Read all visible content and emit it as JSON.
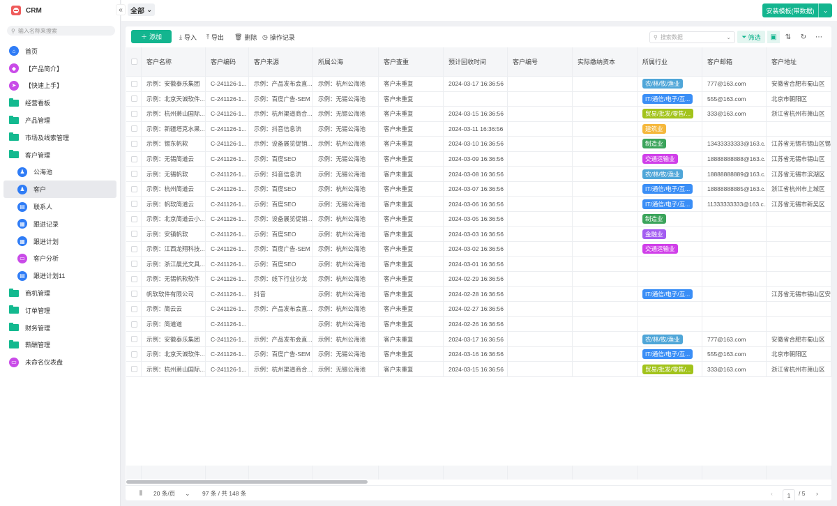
{
  "app": {
    "title": "CRM",
    "search_placeholder": "输入名称来搜索"
  },
  "sidebar": {
    "items": [
      {
        "label": "首页",
        "type": "icon",
        "icon": "home-icon",
        "color": "#2f7cf6",
        "glyph": "⌂"
      },
      {
        "label": "【产品简介】",
        "type": "icon",
        "icon": "tag-icon",
        "color": "#c94be8",
        "glyph": "◆"
      },
      {
        "label": "【快速上手】",
        "type": "icon",
        "icon": "send-icon",
        "color": "#c94be8",
        "glyph": "➤"
      },
      {
        "label": "经营看板",
        "type": "folder"
      },
      {
        "label": "产品管理",
        "type": "folder"
      },
      {
        "label": "市场及线索管理",
        "type": "folder"
      },
      {
        "label": "客户管理",
        "type": "folder",
        "open": true
      },
      {
        "label": "公海池",
        "type": "sub",
        "icon": "users-icon",
        "color": "#2f7cf6",
        "glyph": "♟"
      },
      {
        "label": "客户",
        "type": "sub",
        "icon": "user-icon",
        "color": "#2f7cf6",
        "glyph": "♟",
        "active": true
      },
      {
        "label": "联系人",
        "type": "sub",
        "icon": "contact-icon",
        "color": "#2f7cf6",
        "glyph": "▤"
      },
      {
        "label": "跟进记录",
        "type": "sub",
        "icon": "record-icon",
        "color": "#2f7cf6",
        "glyph": "▦"
      },
      {
        "label": "跟进计划",
        "type": "sub",
        "icon": "calendar-icon",
        "color": "#2f7cf6",
        "glyph": "▦"
      },
      {
        "label": "客户分析",
        "type": "sub",
        "icon": "dashboard-icon",
        "color": "#c94be8",
        "glyph": "▭"
      },
      {
        "label": "跟进计划11",
        "type": "sub",
        "icon": "document-icon",
        "color": "#2f7cf6",
        "glyph": "▤"
      },
      {
        "label": "商机管理",
        "type": "folder"
      },
      {
        "label": "订单管理",
        "type": "folder"
      },
      {
        "label": "财务管理",
        "type": "folder"
      },
      {
        "label": "薪酬管理",
        "type": "folder"
      },
      {
        "label": "未命名仪表盘",
        "type": "icon",
        "icon": "dashboard-icon",
        "color": "#c94be8",
        "glyph": "▭"
      }
    ]
  },
  "topbar": {
    "filter_label": "全部",
    "install_label": "安装模板(带数据)"
  },
  "toolbar": {
    "add": "添加",
    "import": "导入",
    "export": "导出",
    "delete": "删除",
    "log": "操作记录",
    "search_placeholder": "搜索数据",
    "filter": "筛选"
  },
  "table": {
    "columns": [
      "客户名称",
      "客户编码",
      "客户来源",
      "所属公海",
      "客户查重",
      "预计回收时间",
      "客户编号",
      "实际缴纳资本",
      "所属行业",
      "客户邮箱",
      "客户地址"
    ],
    "industry_colors": {
      "农/林/牧/渔业": "#4fa6d8",
      "IT/通信/电子/互...": "#3a8ef6",
      "贸易/批发/零售/...": "#a2c31b",
      "建筑业": "#f5b83c",
      "制造业": "#3ba45b",
      "交通运输业": "#d03fe9",
      "金融业": "#a35df1"
    },
    "rows": [
      [
        "示例：安徽泰乐集团",
        "C-241126-1...",
        "示例：产品发布会直...",
        "示例：杭州公海池",
        "客户未重复",
        "2024-03-17 16:36:56",
        "",
        "",
        "农/林/牧/渔业",
        "777@163.com",
        "安徽省合肥市蜀山区"
      ],
      [
        "示例：北京天诚软件...",
        "C-241126-1...",
        "示例：百度广告-SEM",
        "示例：无锡公海池",
        "客户未重复",
        "",
        "",
        "",
        "IT/通信/电子/互...",
        "555@163.com",
        "北京市朝阳区"
      ],
      [
        "示例：杭州萧山国际...",
        "C-241126-1...",
        "示例：杭州渠道商合...",
        "示例：无锡公海池",
        "客户未重复",
        "2024-03-15 16:36:56",
        "",
        "",
        "贸易/批发/零售/...",
        "333@163.com",
        "浙江省杭州市萧山区"
      ],
      [
        "示例：新疆塔克水果...",
        "C-241126-1...",
        "示例：抖音信息流",
        "示例：无锡公海池",
        "客户未重复",
        "2024-03-11 16:36:56",
        "",
        "",
        "建筑业",
        "",
        ""
      ],
      [
        "示例：锡东帆软",
        "C-241126-1...",
        "示例：设备展览促销...",
        "示例：杭州公海池",
        "客户未重复",
        "2024-03-10 16:36:56",
        "",
        "",
        "制造业",
        "13433333333@163.c...",
        "江苏省无锡市锡山区锡东"
      ],
      [
        "示例：无锡简道云",
        "C-241126-1...",
        "示例：百度SEO",
        "示例：无锡公海池",
        "客户未重复",
        "2024-03-09 16:36:56",
        "",
        "",
        "交通运输业",
        "18888888888@163.c...",
        "江苏省无锡市锡山区"
      ],
      [
        "示例：无锡帆软",
        "C-241126-1...",
        "示例：抖音信息流",
        "示例：无锡公海池",
        "客户未重复",
        "2024-03-08 16:36:56",
        "",
        "",
        "农/林/牧/渔业",
        "18888888889@163.c...",
        "江苏省无锡市滨湖区"
      ],
      [
        "示例：杭州简道云",
        "C-241126-1...",
        "示例：百度SEO",
        "示例：杭州公海池",
        "客户未重复",
        "2024-03-07 16:36:56",
        "",
        "",
        "IT/通信/电子/互...",
        "18888888885@163.c...",
        "浙江省杭州市上城区"
      ],
      [
        "示例：帆软简道云",
        "C-241126-1...",
        "示例：百度SEO",
        "示例：无锡公海池",
        "客户未重复",
        "2024-03-06 16:36:56",
        "",
        "",
        "IT/通信/电子/互...",
        "11333333333@163.c...",
        "江苏省无锡市新吴区"
      ],
      [
        "示例：北京简道云小...",
        "C-241126-1...",
        "示例：设备展览促销...",
        "示例：杭州公海池",
        "客户未重复",
        "2024-03-05 16:36:56",
        "",
        "",
        "制造业",
        "",
        ""
      ],
      [
        "示例：安镇帆软",
        "C-241126-1...",
        "示例：百度SEO",
        "示例：杭州公海池",
        "客户未重复",
        "2024-03-03 16:36:56",
        "",
        "",
        "金融业",
        "",
        ""
      ],
      [
        "示例：江西龙翔科技...",
        "C-241126-1...",
        "示例：百度广告-SEM",
        "示例：杭州公海池",
        "客户未重复",
        "2024-03-02 16:36:56",
        "",
        "",
        "交通运输业",
        "",
        ""
      ],
      [
        "示例：浙江晨光文具...",
        "C-241126-1...",
        "示例：百度SEO",
        "示例：杭州公海池",
        "客户未重复",
        "2024-03-01 16:36:56",
        "",
        "",
        "",
        "",
        ""
      ],
      [
        "示例：无锡帆软软件",
        "C-241126-1...",
        "示例：线下行业沙龙",
        "示例：杭州公海池",
        "客户未重复",
        "2024-02-29 16:36:56",
        "",
        "",
        "",
        "",
        ""
      ],
      [
        "帆软软件有限公司",
        "C-241126-1...",
        "抖音",
        "示例：杭州公海池",
        "客户未重复",
        "2024-02-28 16:36:56",
        "",
        "",
        "IT/通信/电子/互...",
        "",
        "江苏省无锡市锡山区安镇"
      ],
      [
        "示例：简云云",
        "C-241126-1...",
        "示例：产品发布会直...",
        "示例：杭州公海池",
        "客户未重复",
        "2024-02-27 16:36:56",
        "",
        "",
        "",
        "",
        ""
      ],
      [
        "示例：简道道",
        "C-241126-1...",
        "",
        "示例：杭州公海池",
        "客户未重复",
        "2024-02-26 16:36:56",
        "",
        "",
        "",
        "",
        ""
      ],
      [
        "示例：安徽泰乐集团",
        "C-241126-1...",
        "示例：产品发布会直...",
        "示例：杭州公海池",
        "客户未重复",
        "2024-03-17 16:36:56",
        "",
        "",
        "农/林/牧/渔业",
        "777@163.com",
        "安徽省合肥市蜀山区"
      ],
      [
        "示例：北京天诚软件...",
        "C-241126-1...",
        "示例：百度广告-SEM",
        "示例：无锡公海池",
        "客户未重复",
        "2024-03-16 16:36:56",
        "",
        "",
        "IT/通信/电子/互...",
        "555@163.com",
        "北京市朝阳区"
      ],
      [
        "示例：杭州萧山国际...",
        "C-241126-1...",
        "示例：杭州渠道商合...",
        "示例：无锡公海池",
        "客户未重复",
        "2024-03-15 16:36:56",
        "",
        "",
        "贸易/批发/零售/...",
        "333@163.com",
        "浙江省杭州市萧山区"
      ]
    ]
  },
  "pagination": {
    "page_size": "20 条/页",
    "summary": "97 条 / 共 148 条",
    "current_page": "1",
    "total_pages": "/ 5"
  }
}
